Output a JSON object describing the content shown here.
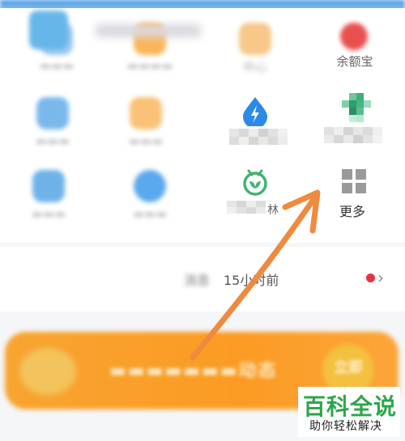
{
  "grid": {
    "row1": [
      {
        "label": "余额宝",
        "icon": "yuebao-icon",
        "color": "#e94f4f"
      },
      {
        "label": "中心",
        "icon": "center-icon"
      }
    ],
    "row3": [
      {
        "label": "更多",
        "icon": "grid-more-icon"
      },
      {
        "label": "林",
        "icon": "forest-icon",
        "color": "#3cb46e"
      }
    ],
    "row2": [
      {
        "icon": "bolt-drop-icon",
        "color": "#2a8ae6"
      }
    ]
  },
  "message": {
    "text": "消息",
    "time": "15小时前"
  },
  "banner": {
    "text": "动态",
    "button": "立即"
  },
  "watermark": {
    "title": "百科全说",
    "subtitle": "助你轻松解决"
  }
}
